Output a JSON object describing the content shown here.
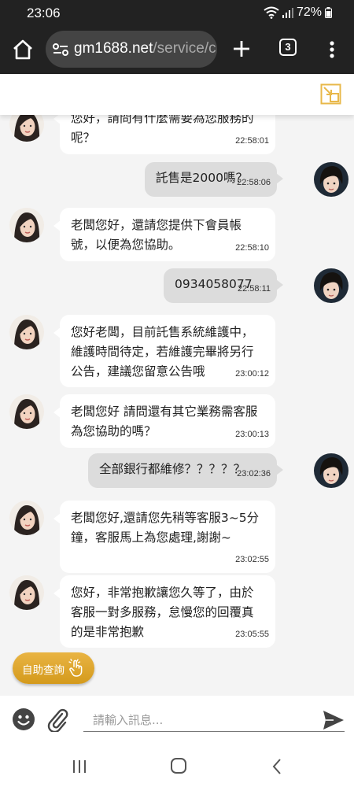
{
  "status": {
    "time": "23:06",
    "battery": "72%"
  },
  "browser": {
    "url_domain": "gm1688.net",
    "url_path": "/service/c",
    "tab_count": "3"
  },
  "chat": {
    "messages": [
      {
        "side": "in",
        "text": "您好，請問有什麼需要為您服務的呢？",
        "time": "22:58:01"
      },
      {
        "side": "out",
        "text": "託售是2000嗎？",
        "time": "22:58:06"
      },
      {
        "side": "in",
        "text": "老闆您好，還請您提供下會員帳號，以便為您協助。",
        "time": "22:58:10"
      },
      {
        "side": "out",
        "text": "0934058077",
        "time": "22:58:11"
      },
      {
        "side": "in",
        "text": "您好老闆，目前託售系統維護中，維護時間待定，若維護完畢將另行公告，建議您留意公告哦",
        "time": "23:00:12"
      },
      {
        "side": "in",
        "text": "老闆您好 請問還有其它業務需客服為您協助的嗎？",
        "time": "23:00:13"
      },
      {
        "side": "out",
        "text": "全部銀行都維修？？？？？",
        "time": "23:02:36"
      },
      {
        "side": "in",
        "text": "老闆您好,還請您先稍等客服3~5分鐘，客服馬上為您處理,謝謝~",
        "time": "23:02:55"
      },
      {
        "side": "in",
        "text": "您好，非常抱歉讓您久等了，由於客服一對多服務，怠慢您的回覆真的是非常抱歉",
        "time": "23:05:55"
      }
    ],
    "self_service_label": "自助查詢",
    "input_placeholder": "請輸入訊息..."
  },
  "colors": {
    "agent_bubble": "#ffffff",
    "user_bubble": "#dcdcdc",
    "chat_background": "#f4f4f4",
    "self_service_button": "#e0a82e",
    "resize_icon": "#e8b84a"
  }
}
